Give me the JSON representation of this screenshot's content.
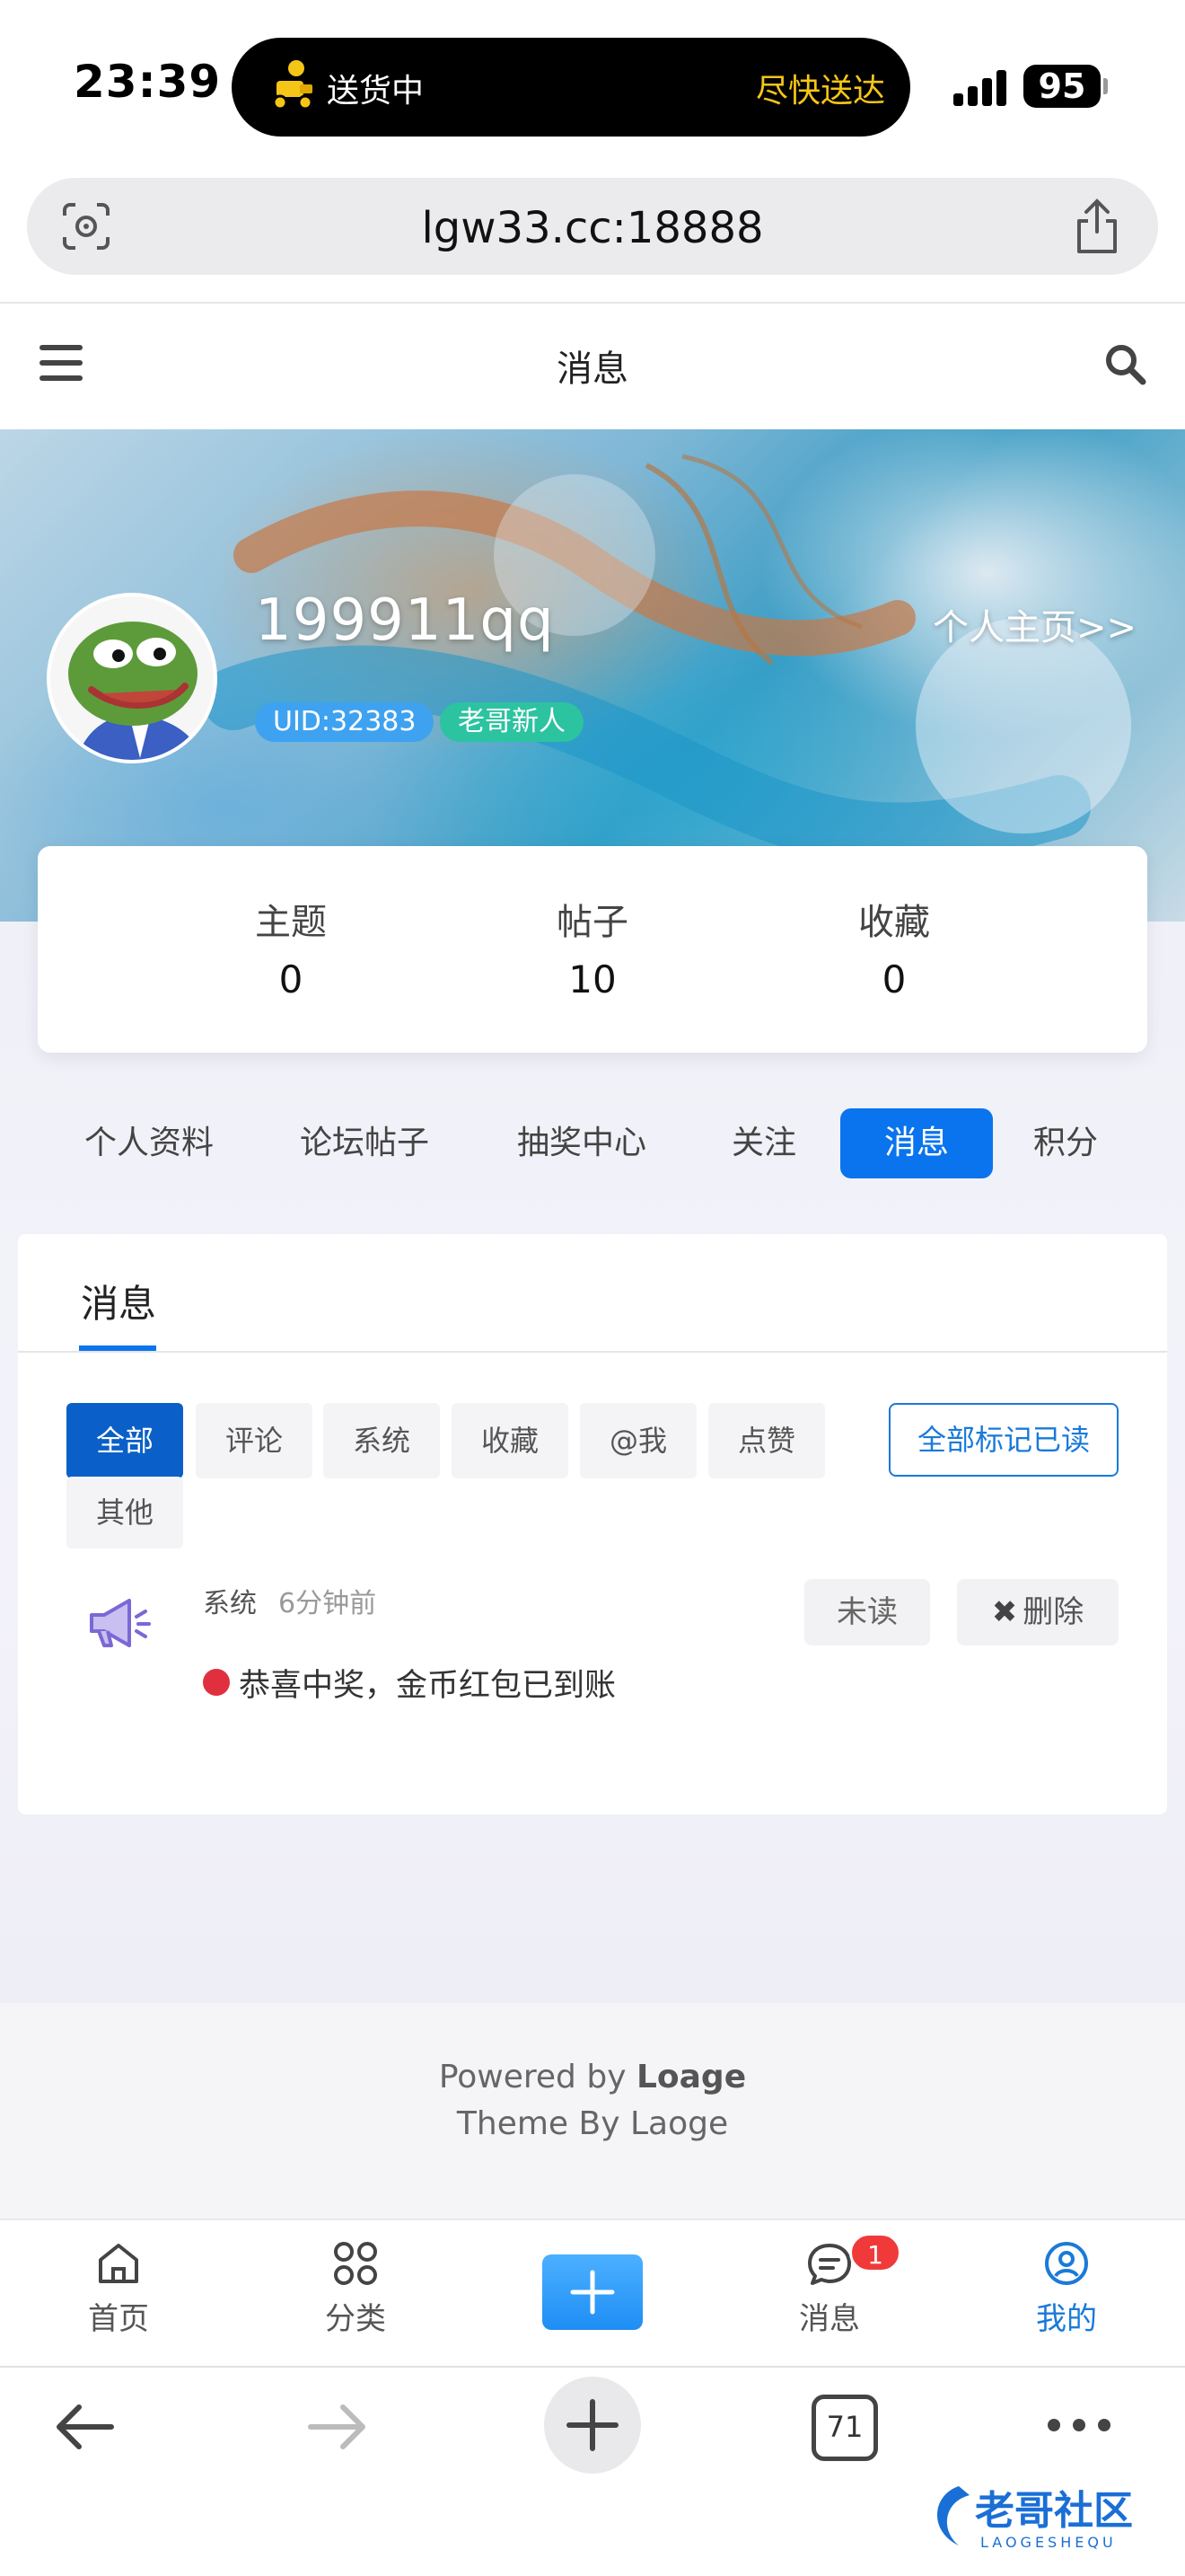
{
  "status_bar": {
    "time": "23:39",
    "island_left": "送货中",
    "island_right": "尽快送达",
    "battery": "95"
  },
  "browser": {
    "url": "lgw33.cc:18888",
    "open_tabs": "71"
  },
  "header": {
    "title": "消息"
  },
  "profile": {
    "username": "199911qq",
    "profile_link": "个人主页>>",
    "uid": "UID:32383",
    "level": "老哥新人"
  },
  "stats": [
    {
      "label": "主题",
      "value": "0"
    },
    {
      "label": "帖子",
      "value": "10"
    },
    {
      "label": "收藏",
      "value": "0"
    }
  ],
  "profile_tabs": [
    {
      "label": "个人资料",
      "active": false
    },
    {
      "label": "论坛帖子",
      "active": false
    },
    {
      "label": "抽奖中心",
      "active": false
    },
    {
      "label": "关注",
      "active": false
    },
    {
      "label": "消息",
      "active": true
    },
    {
      "label": "积分",
      "active": false
    }
  ],
  "messages": {
    "panel_title": "消息",
    "filters": [
      {
        "label": "全部",
        "active": true
      },
      {
        "label": "评论",
        "active": false
      },
      {
        "label": "系统",
        "active": false
      },
      {
        "label": "收藏",
        "active": false
      },
      {
        "label": "@我",
        "active": false
      },
      {
        "label": "点赞",
        "active": false
      },
      {
        "label": "其他",
        "active": false
      }
    ],
    "mark_all_read": "全部标记已读",
    "items": [
      {
        "type": "系统",
        "time": "6分钟前",
        "text": "恭喜中奖，金币红包已到账",
        "unread_label": "未读",
        "delete_label": "删除",
        "icon": "megaphone-icon"
      }
    ]
  },
  "footer": {
    "powered_prefix": "Powered by ",
    "powered_brand": "Loage",
    "theme_line": "Theme By Laoge"
  },
  "tabbar": {
    "items": [
      {
        "label": "首页",
        "icon": "home-icon"
      },
      {
        "label": "分类",
        "icon": "grid-icon"
      },
      {
        "label": "",
        "icon": "plus-icon"
      },
      {
        "label": "消息",
        "icon": "chat-icon",
        "badge": "1"
      },
      {
        "label": "我的",
        "icon": "user-icon",
        "active": true
      }
    ]
  },
  "watermark": {
    "title": "老哥社区",
    "subtitle": "LAOGESHEQU"
  },
  "colors": {
    "accent": "#0a74ee",
    "unread_dot": "#e0303f",
    "badge": "#f03a3a",
    "uid_badge": "#3ea2f0",
    "level_badge": "#2cc3a0"
  }
}
